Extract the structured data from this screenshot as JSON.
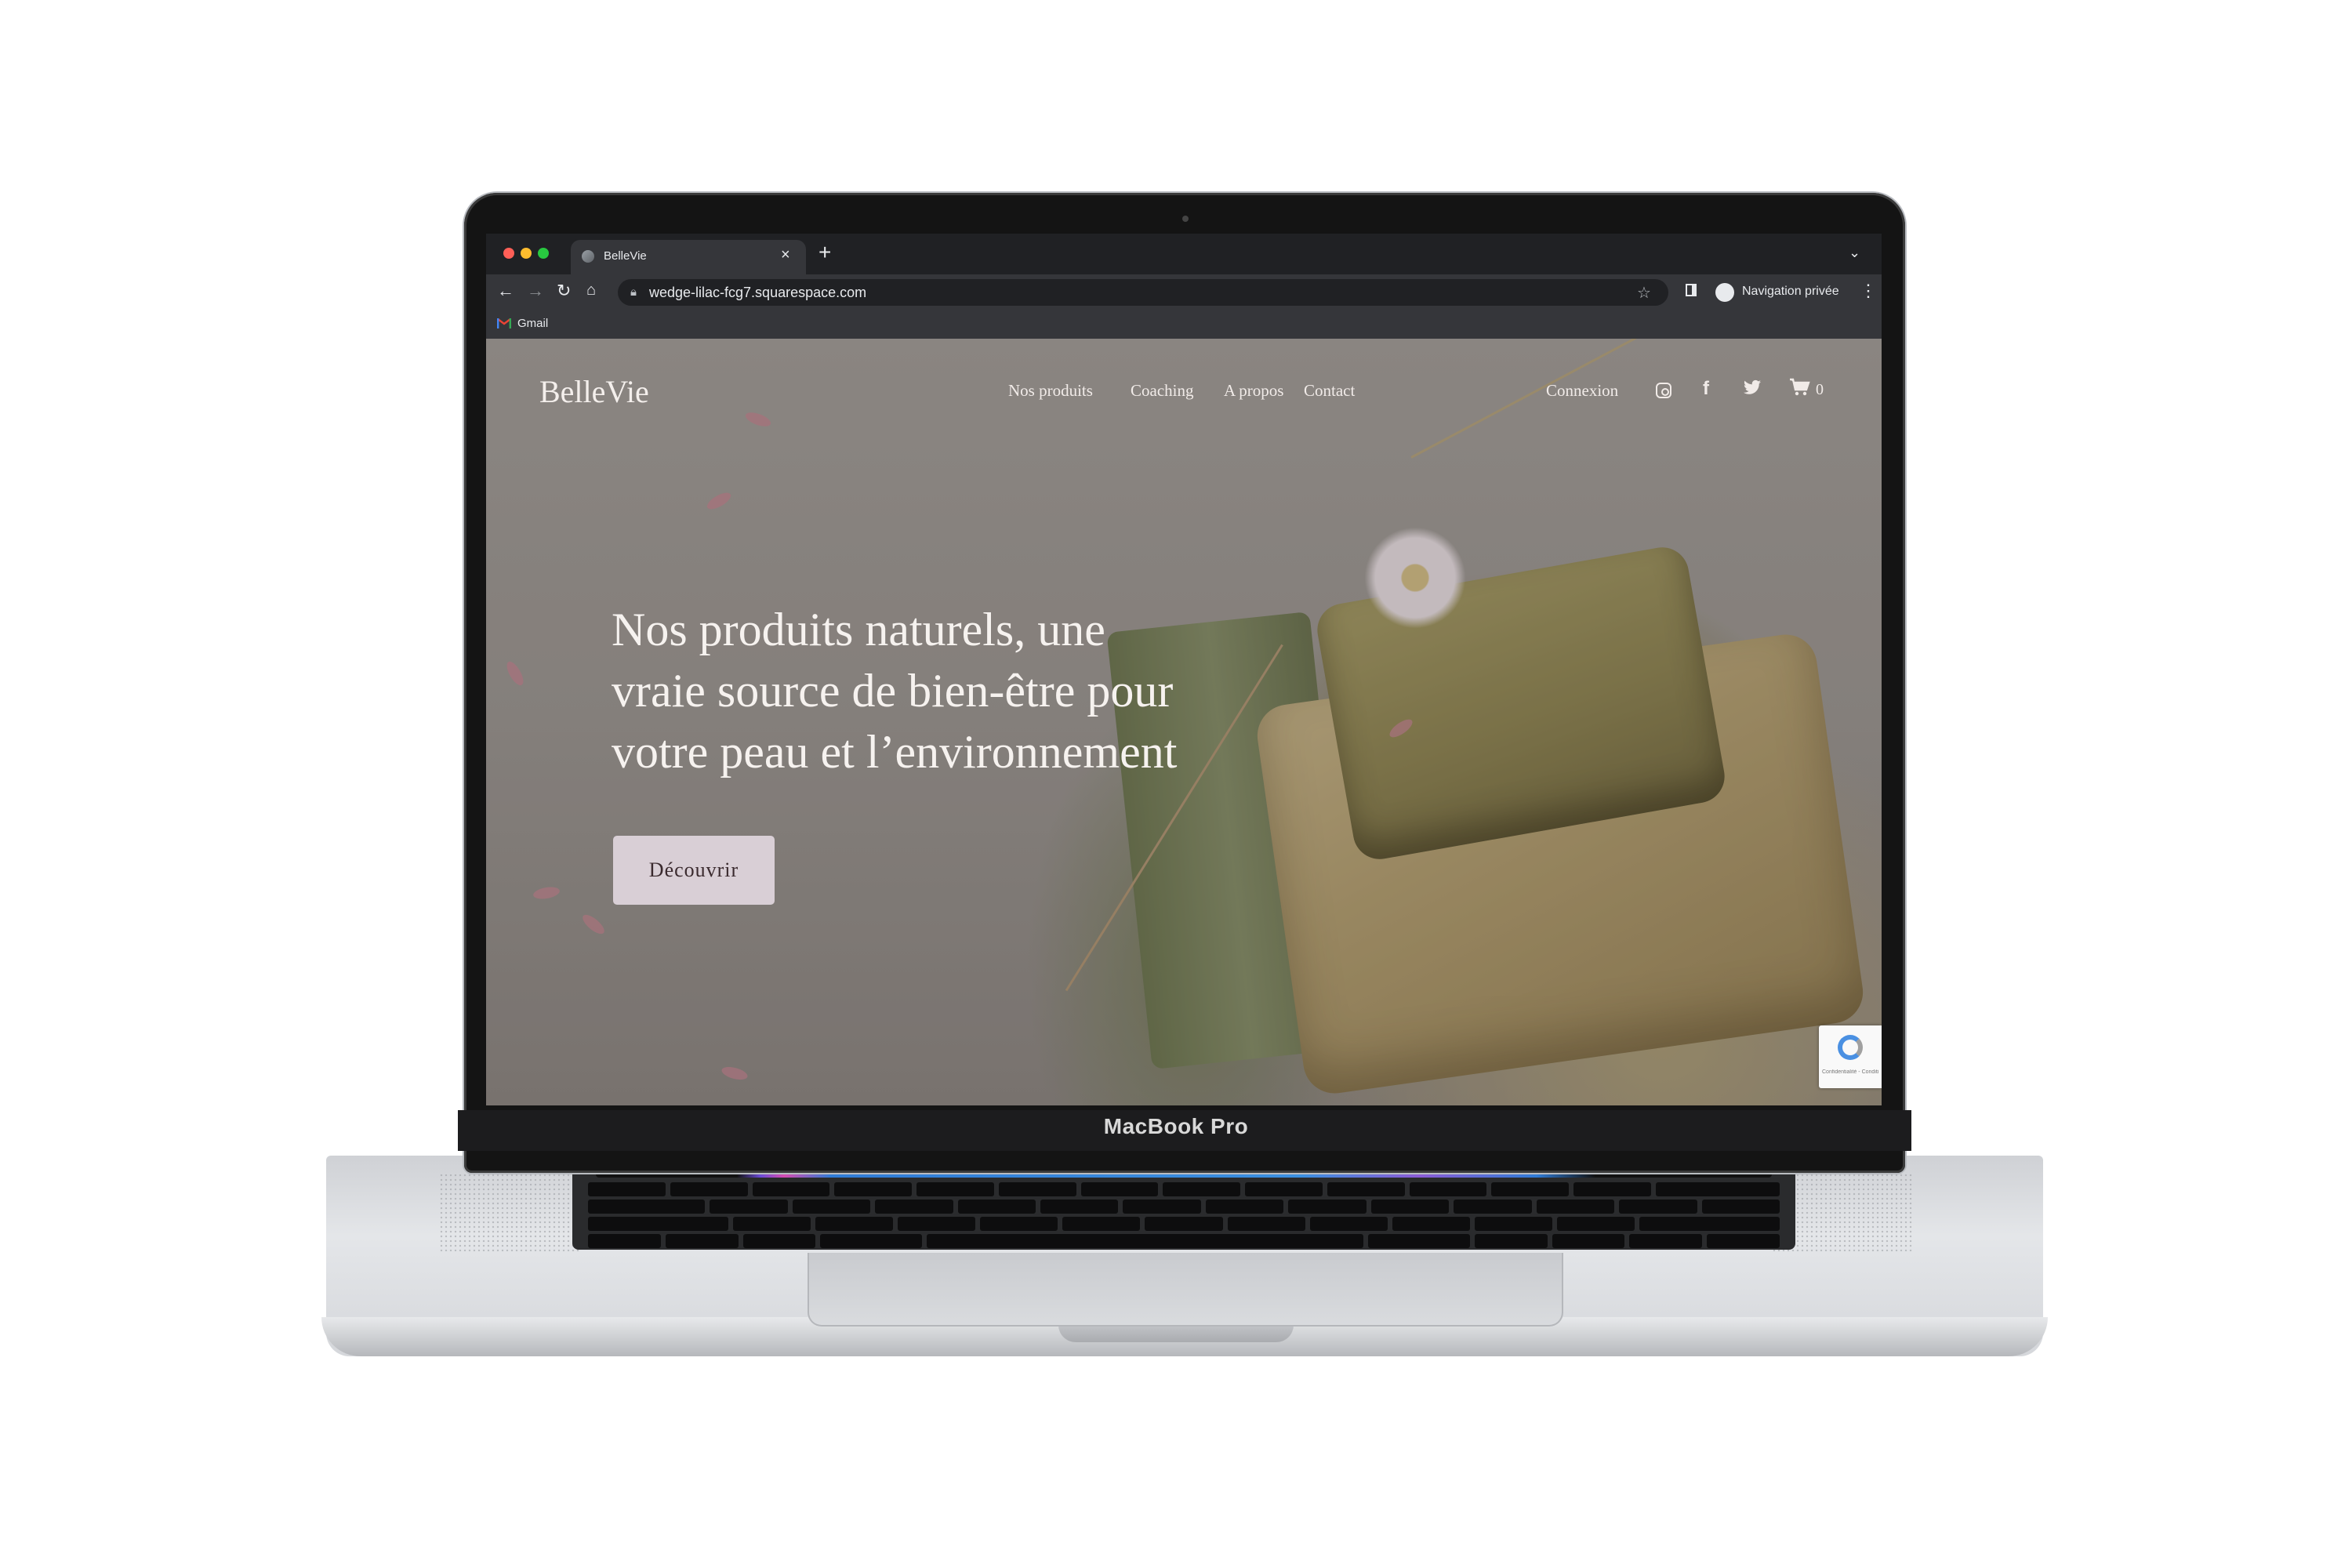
{
  "browser": {
    "tab_title": "BelleVie",
    "tab_close": "×",
    "new_tab": "+",
    "url": "wedge-lilac-fcg7.squarespace.com",
    "incognito_label": "Navigation privée",
    "bookmark_gmail": "Gmail",
    "icons": {
      "back": "←",
      "forward": "→",
      "reload": "↻",
      "home": "⌂",
      "lock": "🔒",
      "star": "☆",
      "kebab": "⋮",
      "tab_menu": "⌄"
    }
  },
  "site": {
    "brand": "BelleVie",
    "nav": [
      "Nos produits",
      "Coaching",
      "A propos",
      "Contact"
    ],
    "login": "Connexion",
    "cart_count": "0",
    "hero_title": "Nos produits naturels, une vraie source de bien-être pour votre peau et l’environnement",
    "cta": "Découvrir",
    "recaptcha_text": "Confidentialité - Conditions"
  },
  "device": {
    "model": "MacBook Pro"
  },
  "colors": {
    "cta_bg": "#d9cfd6",
    "chrome_dark": "#202124",
    "chrome_toolbar": "#35363a"
  }
}
